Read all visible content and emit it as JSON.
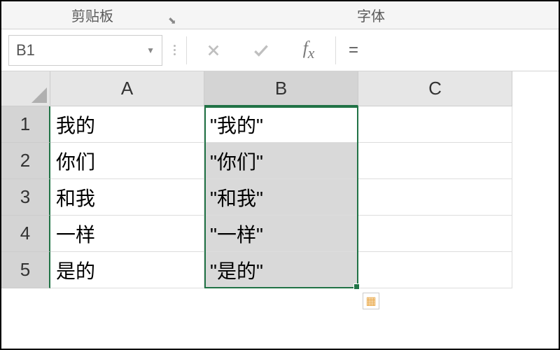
{
  "ribbon": {
    "clipboard_label": "剪贴板",
    "font_label": "字体"
  },
  "formula_bar": {
    "name_box": "B1",
    "formula": "="
  },
  "columns": [
    "A",
    "B",
    "C"
  ],
  "rows": [
    {
      "num": "1",
      "A": "我的",
      "B": "\"我的\"",
      "C": ""
    },
    {
      "num": "2",
      "A": "你们",
      "B": "\"你们\"",
      "C": ""
    },
    {
      "num": "3",
      "A": "和我",
      "B": "\"和我\"",
      "C": ""
    },
    {
      "num": "4",
      "A": "一样",
      "B": "\"一样\"",
      "C": ""
    },
    {
      "num": "5",
      "A": "是的",
      "B": "\"是的\"",
      "C": ""
    }
  ],
  "selection": {
    "active_cell": "B1",
    "range": "B1:B5",
    "selected_column": "B"
  }
}
